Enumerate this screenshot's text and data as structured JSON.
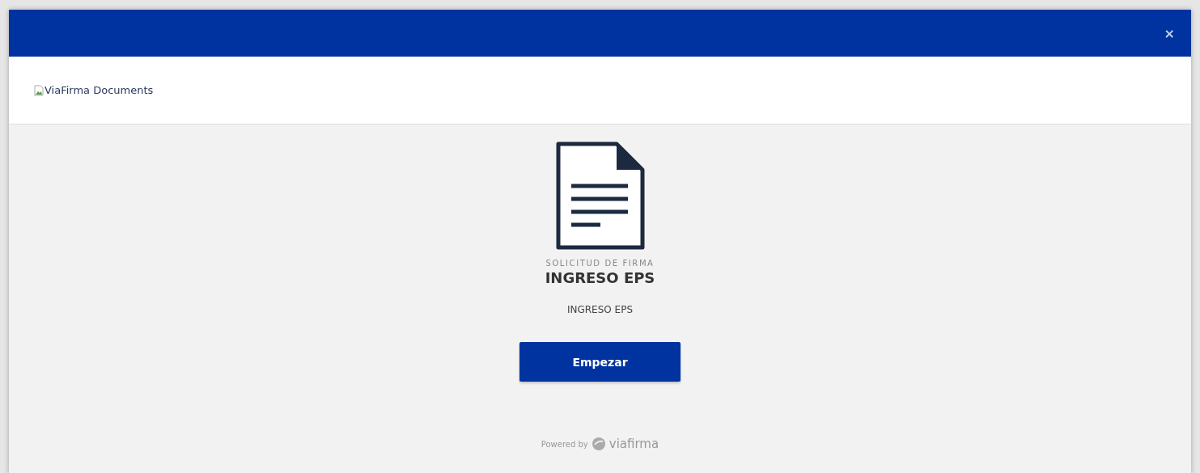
{
  "top_bar": {
    "close": "×"
  },
  "header": {
    "logo_alt": "ViaFirma Documents"
  },
  "request": {
    "kind_label": "SOLICITUD DE FIRMA",
    "title": "INGRESO EPS",
    "description": "INGRESO EPS",
    "button": "Empezar"
  },
  "footer": {
    "powered_by": "Powered by",
    "brand": "viafirma"
  }
}
